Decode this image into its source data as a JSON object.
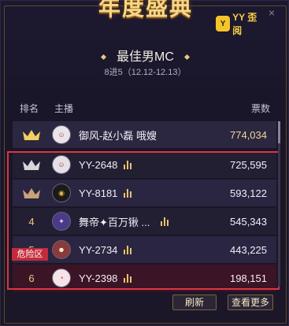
{
  "banner": {
    "title": "年度盛典"
  },
  "logo": {
    "mascot": "Y",
    "brand": "YY 歪阅"
  },
  "window": {
    "close": "×"
  },
  "award": {
    "title": "最佳男MC",
    "subtitle": "8进5（12.12-12.13）"
  },
  "columns": {
    "rank": "排名",
    "host": "主播",
    "votes": "票数"
  },
  "entries": [
    {
      "rank": "1",
      "rank_display": "crown-gold",
      "avatar_text": "",
      "name": "御风-赵小磊 哦嫂",
      "votes": "774,034",
      "has_bars": false
    },
    {
      "rank": "2",
      "rank_display": "crown-silver",
      "avatar_text": "",
      "name": "YY-2648",
      "votes": "725,595",
      "has_bars": true
    },
    {
      "rank": "3",
      "rank_display": "crown-bronze",
      "avatar_text": "",
      "name": "YY-8181",
      "votes": "593,122",
      "has_bars": true
    },
    {
      "rank": "4",
      "rank_display": "number",
      "avatar_text": "",
      "name": "舞帝✦百万锹 ...",
      "votes": "545,343",
      "has_bars": true
    },
    {
      "rank": "5",
      "rank_display": "number",
      "avatar_text": "",
      "name": "YY-2734",
      "votes": "443,225",
      "has_bars": true
    },
    {
      "rank": "6",
      "rank_display": "number",
      "avatar_text": "",
      "name": "YY-2398",
      "votes": "198,151",
      "has_bars": true
    }
  ],
  "danger_zone": {
    "label": "危险区"
  },
  "buttons": {
    "refresh": "刷新",
    "more": "查看更多"
  },
  "colors": {
    "accent": "#e9c879",
    "danger": "#e0343f",
    "gold_crown": "#f2d060",
    "silver_crown": "#d9d5dc"
  }
}
